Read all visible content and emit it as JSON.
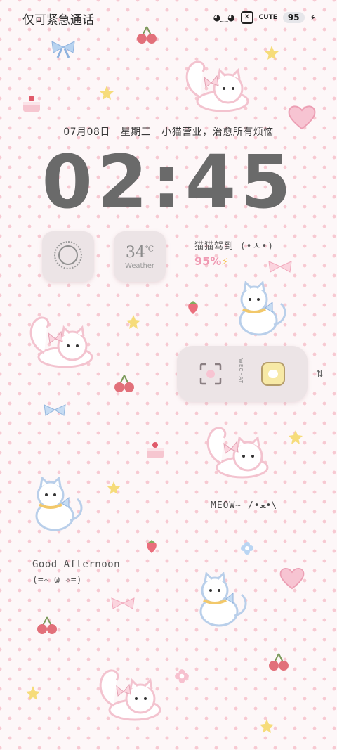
{
  "status_bar": {
    "carrier": "仅可紧急通话",
    "icons": [
      "face-icon",
      "close-box-icon",
      "cute-icon"
    ],
    "cute_text": "CUTE",
    "battery": "95"
  },
  "lock": {
    "date": "07月08日",
    "weekday": "星期三",
    "tagline": "小猫营业，治愈所有烦恼",
    "time": "02:45"
  },
  "weather_widget": {
    "temperature": "34",
    "unit": "℃",
    "label": "Weather"
  },
  "checkin": {
    "title": "猫猫驾到 (•ㅅ•)",
    "percent": "95%"
  },
  "dock": {
    "label": "WECHAT"
  },
  "texts": {
    "meow": "MEOW~  /•ﻌ•\\",
    "greeting": "Good Afternoon",
    "kaomoji": "(=✧ ω ✧=)"
  },
  "colors": {
    "background": "#fdf7f8",
    "dots": "#f7c9d2",
    "clock": "#6a6a6a",
    "accent_pink": "#f09ab3",
    "star": "#f6dc7a"
  }
}
